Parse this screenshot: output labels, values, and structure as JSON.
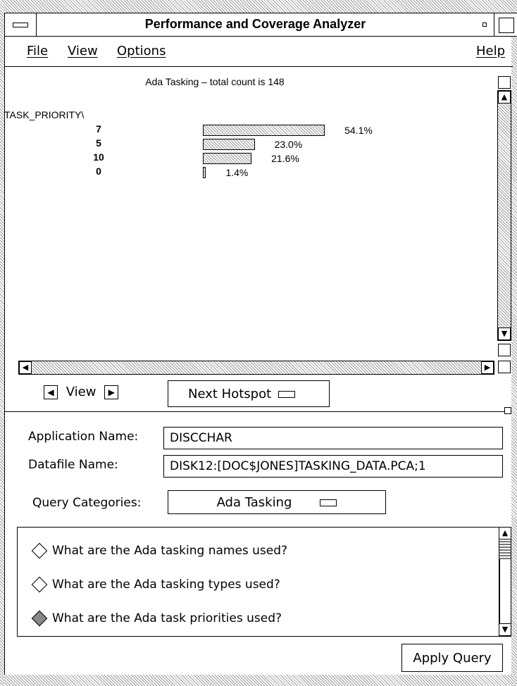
{
  "window": {
    "title": "Performance and Coverage Analyzer"
  },
  "menu": {
    "file": "File",
    "view": "View",
    "options": "Options",
    "help": "Help"
  },
  "chart": {
    "title": "Ada Tasking – total count is 148",
    "attribute_label": "TASK_PRIORITY\\",
    "rows": [
      {
        "category": "7",
        "percent_label": "54.1%"
      },
      {
        "category": "5",
        "percent_label": "23.0%"
      },
      {
        "category": "10",
        "percent_label": "21.6%"
      },
      {
        "category": "0",
        "percent_label": "1.4%"
      }
    ]
  },
  "chart_data": {
    "type": "bar",
    "orientation": "horizontal",
    "title": "Ada Tasking – total count is 148",
    "ylabel": "TASK_PRIORITY\\",
    "categories": [
      "7",
      "5",
      "10",
      "0"
    ],
    "values": [
      54.1,
      23.0,
      21.6,
      1.4
    ],
    "xlim": [
      0,
      100
    ]
  },
  "controls": {
    "view_label": "View",
    "next_hotspot_label": "Next Hotspot"
  },
  "form": {
    "application_name_label": "Application Name:",
    "application_name_value": "DISCCHAR",
    "datafile_name_label": "Datafile Name:",
    "datafile_name_value": "DISK12:[DOC$JONES]TASKING_DATA.PCA;1",
    "query_categories_label": "Query Categories:",
    "query_categories_value": "Ada Tasking"
  },
  "queries": [
    {
      "label": "What are the Ada tasking names used?",
      "selected": false
    },
    {
      "label": "What are the Ada tasking types used?",
      "selected": false
    },
    {
      "label": "What are the Ada task priorities used?",
      "selected": true
    }
  ],
  "apply_button": "Apply Query",
  "colors": {
    "bar_fill": "#9a9a9a",
    "frame_dither": "#9a9a9a"
  }
}
